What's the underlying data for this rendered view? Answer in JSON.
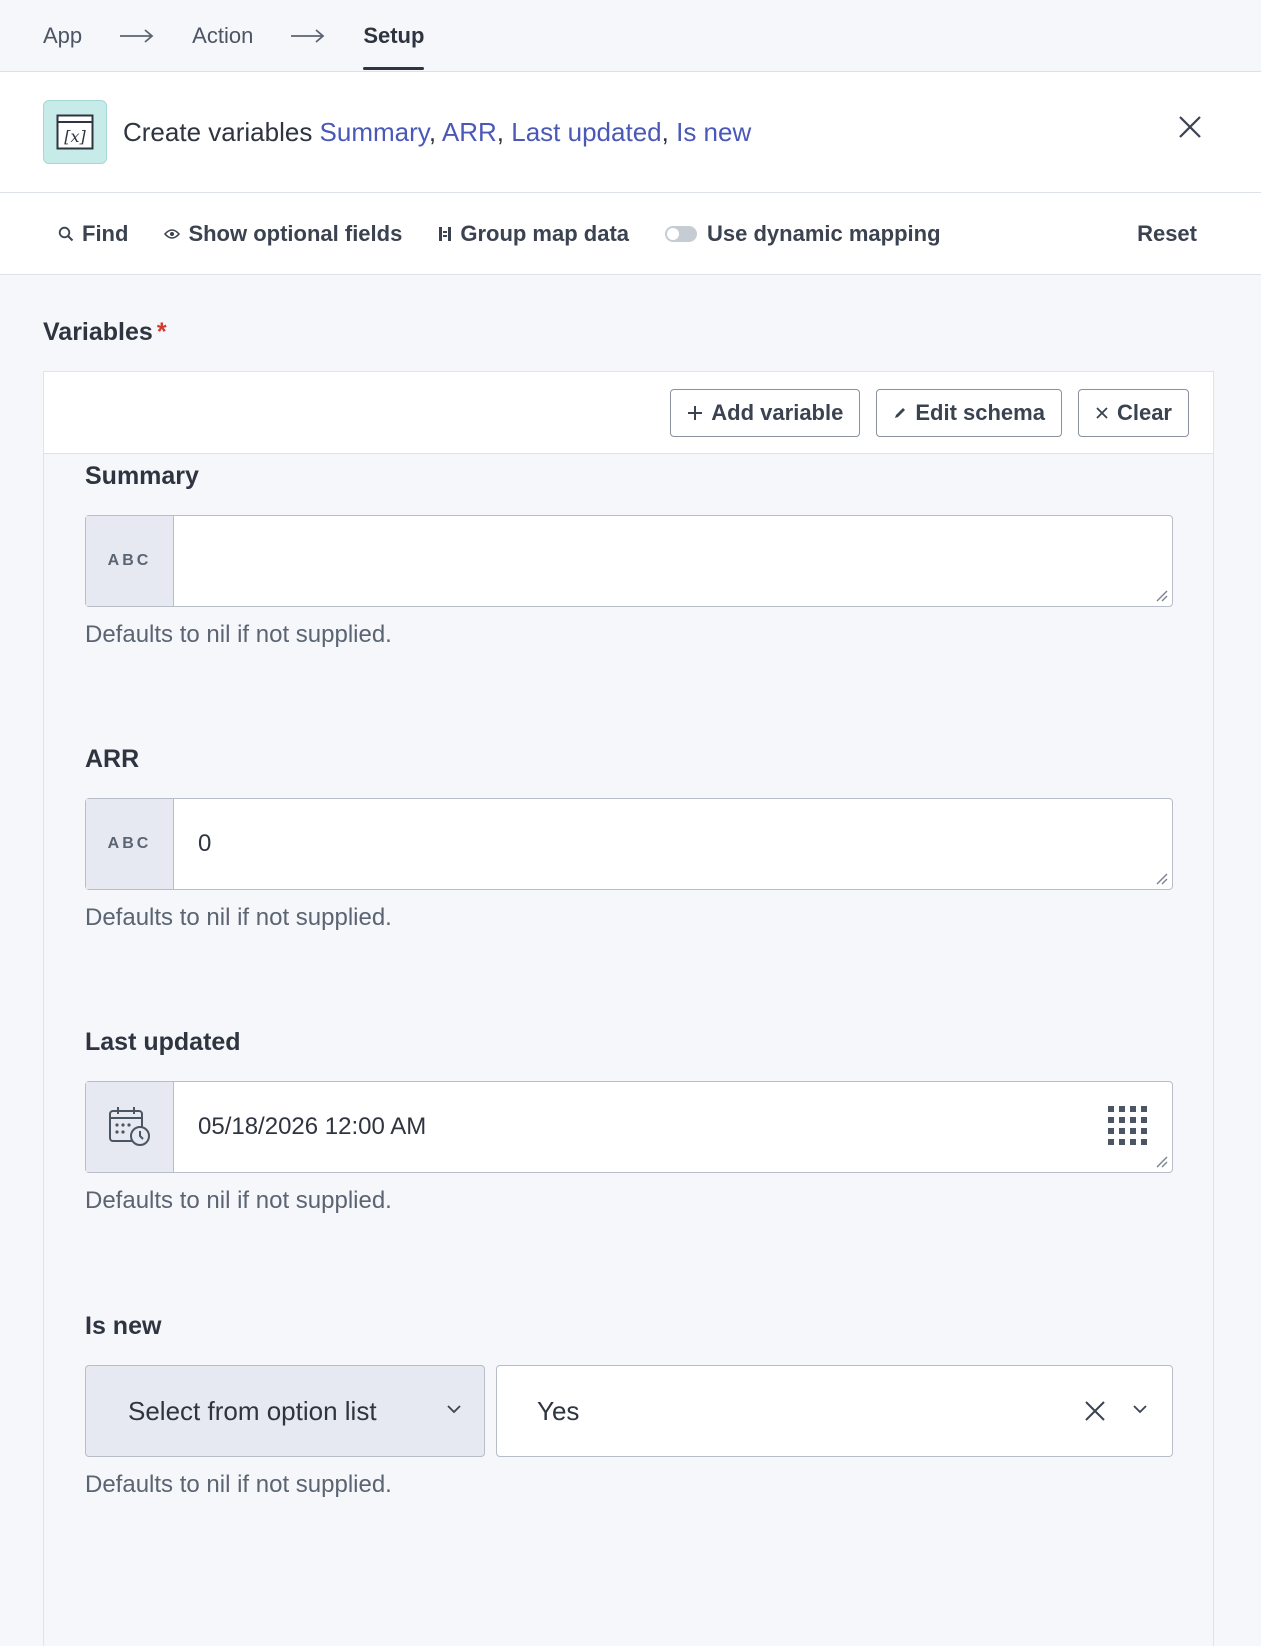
{
  "breadcrumb": {
    "items": [
      "App",
      "Action",
      "Setup"
    ],
    "active": "Setup"
  },
  "header": {
    "prefix": "Create variables",
    "variables": [
      "Summary",
      "ARR",
      "Last updated",
      "Is new"
    ],
    "separator": ","
  },
  "toolbar": {
    "find": "Find",
    "show_optional": "Show optional fields",
    "group_map": "Group map data",
    "dynamic_mapping": "Use dynamic mapping",
    "reset": "Reset"
  },
  "section": {
    "label": "Variables",
    "required_mark": "*"
  },
  "panel": {
    "add_variable": "Add variable",
    "edit_schema": "Edit schema",
    "clear": "Clear"
  },
  "fields": [
    {
      "label": "Summary",
      "type_badge": "ABC",
      "value": "",
      "hint": "Defaults to nil if not supplied."
    },
    {
      "label": "ARR",
      "type_badge": "ABC",
      "value": "0",
      "hint": "Defaults to nil if not supplied."
    },
    {
      "label": "Last updated",
      "type_icon": "calendar-clock-icon",
      "value": "05/18/2026 12:00 AM",
      "hint": "Defaults to nil if not supplied."
    },
    {
      "label": "Is new",
      "mode": "Select from option list",
      "value": "Yes",
      "hint": "Defaults to nil if not supplied."
    }
  ],
  "colors": {
    "accent_link": "#4a58b8",
    "required": "#d9372b",
    "icon_bg": "#c7ebe9"
  }
}
